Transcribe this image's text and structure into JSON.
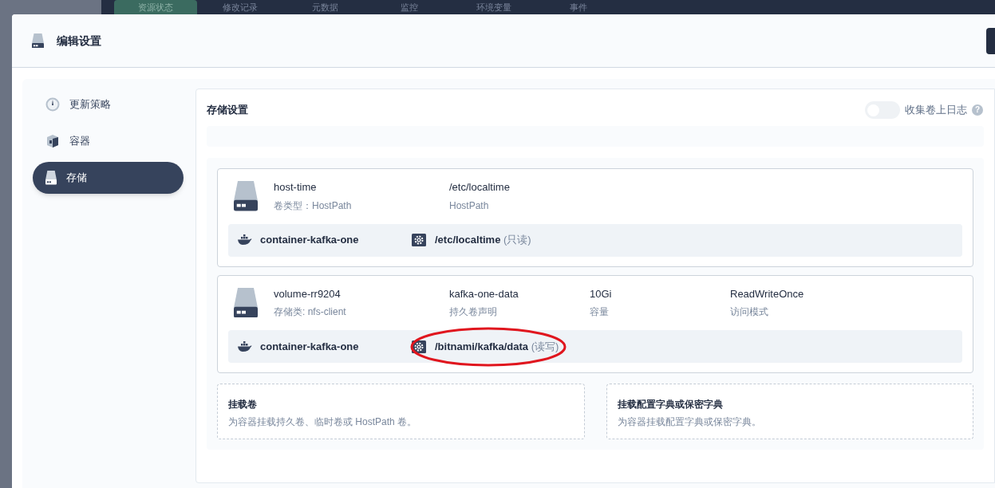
{
  "backdrop_tabs": [
    {
      "label": "资源状态",
      "selected": true
    },
    {
      "label": "修改记录",
      "selected": false
    },
    {
      "label": "元数据",
      "selected": false
    },
    {
      "label": "监控",
      "selected": false
    },
    {
      "label": "环境变量",
      "selected": false
    },
    {
      "label": "事件",
      "selected": false
    }
  ],
  "dialog": {
    "title": "编辑设置"
  },
  "sidebar": {
    "items": [
      {
        "label": "更新策略",
        "selected": false
      },
      {
        "label": "容器",
        "selected": false
      },
      {
        "label": "存储",
        "selected": true
      }
    ]
  },
  "storage": {
    "title": "存储设置",
    "collect_logs": {
      "label": "收集卷上日志",
      "help": "?",
      "on": false
    },
    "volumes": [
      {
        "name": "host-time",
        "subtitle": "卷类型：HostPath",
        "fields": [
          {
            "value": "/etc/localtime",
            "label": "HostPath"
          }
        ],
        "mounts": [
          {
            "container": "container-kafka-one",
            "path": "/etc/localtime",
            "mode": "(只读)",
            "annotated": false
          }
        ]
      },
      {
        "name": "volume-rr9204",
        "subtitle": "存储类: nfs-client",
        "fields": [
          {
            "value": "kafka-one-data",
            "label": "持久卷声明"
          },
          {
            "value": "10Gi",
            "label": "容量"
          },
          {
            "value": "ReadWriteOnce",
            "label": "访问模式"
          }
        ],
        "mounts": [
          {
            "container": "container-kafka-one",
            "path": "/bitnami/kafka/data",
            "mode": "(读写)",
            "annotated": true
          }
        ]
      }
    ],
    "add_cards": [
      {
        "title": "挂载卷",
        "description": "为容器挂载持久卷、临时卷或 HostPath 卷。"
      },
      {
        "title": "挂载配置字典或保密字典",
        "description": "为容器挂载配置字典或保密字典。"
      }
    ]
  }
}
